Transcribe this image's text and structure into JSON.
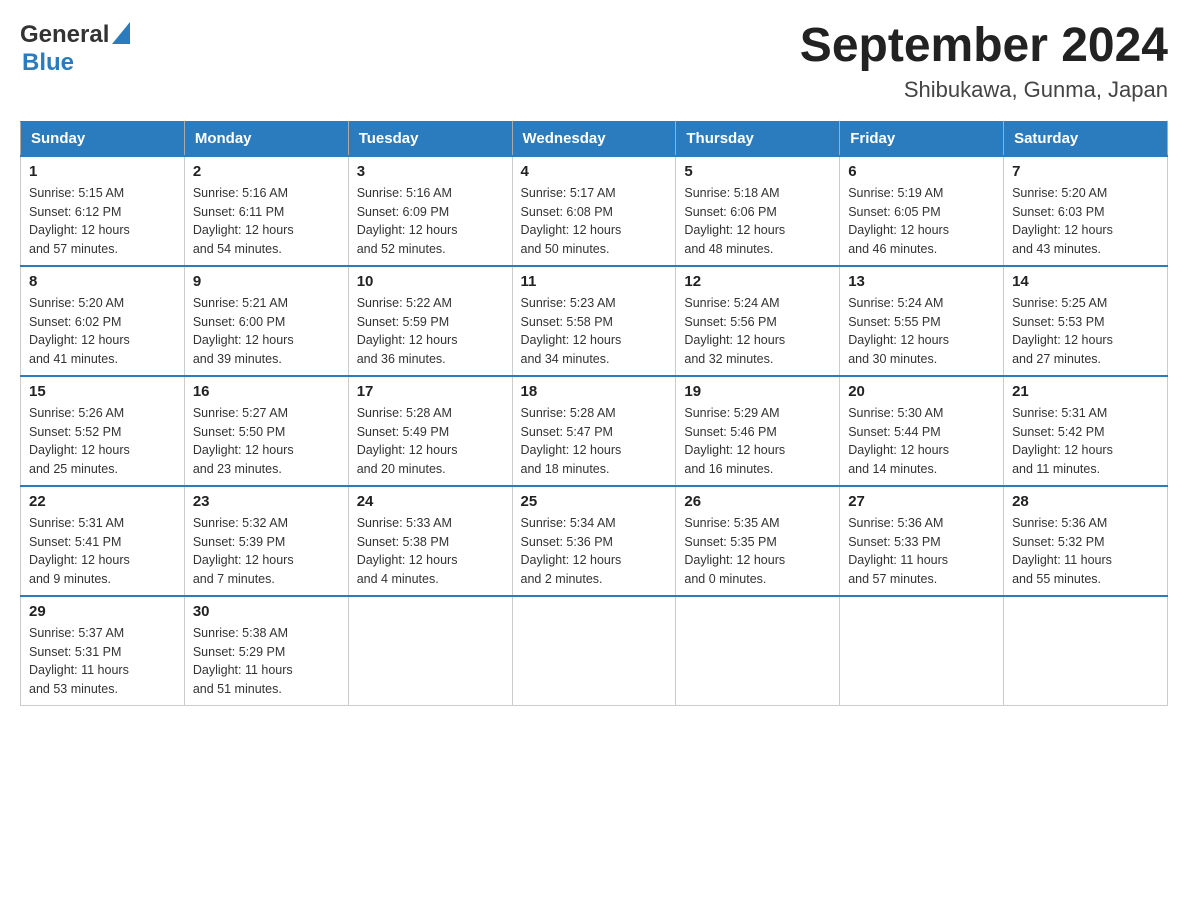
{
  "header": {
    "logo_general": "General",
    "logo_blue": "Blue",
    "month_title": "September 2024",
    "location": "Shibukawa, Gunma, Japan"
  },
  "weekdays": [
    "Sunday",
    "Monday",
    "Tuesday",
    "Wednesday",
    "Thursday",
    "Friday",
    "Saturday"
  ],
  "weeks": [
    [
      {
        "day": "1",
        "sunrise": "5:15 AM",
        "sunset": "6:12 PM",
        "daylight": "12 hours and 57 minutes."
      },
      {
        "day": "2",
        "sunrise": "5:16 AM",
        "sunset": "6:11 PM",
        "daylight": "12 hours and 54 minutes."
      },
      {
        "day": "3",
        "sunrise": "5:16 AM",
        "sunset": "6:09 PM",
        "daylight": "12 hours and 52 minutes."
      },
      {
        "day": "4",
        "sunrise": "5:17 AM",
        "sunset": "6:08 PM",
        "daylight": "12 hours and 50 minutes."
      },
      {
        "day": "5",
        "sunrise": "5:18 AM",
        "sunset": "6:06 PM",
        "daylight": "12 hours and 48 minutes."
      },
      {
        "day": "6",
        "sunrise": "5:19 AM",
        "sunset": "6:05 PM",
        "daylight": "12 hours and 46 minutes."
      },
      {
        "day": "7",
        "sunrise": "5:20 AM",
        "sunset": "6:03 PM",
        "daylight": "12 hours and 43 minutes."
      }
    ],
    [
      {
        "day": "8",
        "sunrise": "5:20 AM",
        "sunset": "6:02 PM",
        "daylight": "12 hours and 41 minutes."
      },
      {
        "day": "9",
        "sunrise": "5:21 AM",
        "sunset": "6:00 PM",
        "daylight": "12 hours and 39 minutes."
      },
      {
        "day": "10",
        "sunrise": "5:22 AM",
        "sunset": "5:59 PM",
        "daylight": "12 hours and 36 minutes."
      },
      {
        "day": "11",
        "sunrise": "5:23 AM",
        "sunset": "5:58 PM",
        "daylight": "12 hours and 34 minutes."
      },
      {
        "day": "12",
        "sunrise": "5:24 AM",
        "sunset": "5:56 PM",
        "daylight": "12 hours and 32 minutes."
      },
      {
        "day": "13",
        "sunrise": "5:24 AM",
        "sunset": "5:55 PM",
        "daylight": "12 hours and 30 minutes."
      },
      {
        "day": "14",
        "sunrise": "5:25 AM",
        "sunset": "5:53 PM",
        "daylight": "12 hours and 27 minutes."
      }
    ],
    [
      {
        "day": "15",
        "sunrise": "5:26 AM",
        "sunset": "5:52 PM",
        "daylight": "12 hours and 25 minutes."
      },
      {
        "day": "16",
        "sunrise": "5:27 AM",
        "sunset": "5:50 PM",
        "daylight": "12 hours and 23 minutes."
      },
      {
        "day": "17",
        "sunrise": "5:28 AM",
        "sunset": "5:49 PM",
        "daylight": "12 hours and 20 minutes."
      },
      {
        "day": "18",
        "sunrise": "5:28 AM",
        "sunset": "5:47 PM",
        "daylight": "12 hours and 18 minutes."
      },
      {
        "day": "19",
        "sunrise": "5:29 AM",
        "sunset": "5:46 PM",
        "daylight": "12 hours and 16 minutes."
      },
      {
        "day": "20",
        "sunrise": "5:30 AM",
        "sunset": "5:44 PM",
        "daylight": "12 hours and 14 minutes."
      },
      {
        "day": "21",
        "sunrise": "5:31 AM",
        "sunset": "5:42 PM",
        "daylight": "12 hours and 11 minutes."
      }
    ],
    [
      {
        "day": "22",
        "sunrise": "5:31 AM",
        "sunset": "5:41 PM",
        "daylight": "12 hours and 9 minutes."
      },
      {
        "day": "23",
        "sunrise": "5:32 AM",
        "sunset": "5:39 PM",
        "daylight": "12 hours and 7 minutes."
      },
      {
        "day": "24",
        "sunrise": "5:33 AM",
        "sunset": "5:38 PM",
        "daylight": "12 hours and 4 minutes."
      },
      {
        "day": "25",
        "sunrise": "5:34 AM",
        "sunset": "5:36 PM",
        "daylight": "12 hours and 2 minutes."
      },
      {
        "day": "26",
        "sunrise": "5:35 AM",
        "sunset": "5:35 PM",
        "daylight": "12 hours and 0 minutes."
      },
      {
        "day": "27",
        "sunrise": "5:36 AM",
        "sunset": "5:33 PM",
        "daylight": "11 hours and 57 minutes."
      },
      {
        "day": "28",
        "sunrise": "5:36 AM",
        "sunset": "5:32 PM",
        "daylight": "11 hours and 55 minutes."
      }
    ],
    [
      {
        "day": "29",
        "sunrise": "5:37 AM",
        "sunset": "5:31 PM",
        "daylight": "11 hours and 53 minutes."
      },
      {
        "day": "30",
        "sunrise": "5:38 AM",
        "sunset": "5:29 PM",
        "daylight": "11 hours and 51 minutes."
      },
      null,
      null,
      null,
      null,
      null
    ]
  ],
  "labels": {
    "sunrise": "Sunrise:",
    "sunset": "Sunset:",
    "daylight": "Daylight:"
  }
}
